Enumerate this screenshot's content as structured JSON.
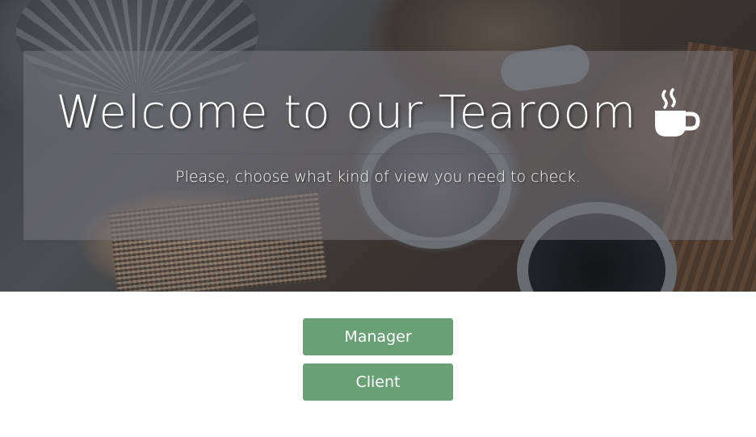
{
  "hero": {
    "title": "Welcome to our Tearoom",
    "title_icon": "coffee-cup-icon",
    "subtitle": "Please, choose what kind of view you need to check."
  },
  "actions": {
    "manager_label": "Manager",
    "client_label": "Client"
  },
  "colors": {
    "button_bg": "#6aa075",
    "button_text": "#ffffff",
    "overlay": "rgba(120,118,124,0.55)"
  }
}
